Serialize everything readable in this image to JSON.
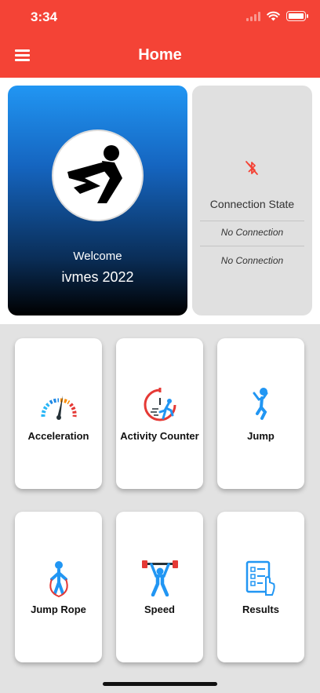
{
  "status_bar": {
    "time": "3:34"
  },
  "header": {
    "title": "Home",
    "menu_icon": "hamburger-menu-icon"
  },
  "welcome": {
    "greeting": "Welcome",
    "name": "ivmes 2022",
    "logo_icon": "ivmes-logo-icon"
  },
  "connection": {
    "icon": "bluetooth-disabled-icon",
    "title": "Connection State",
    "values": [
      "No Connection",
      "No Connection"
    ]
  },
  "tiles": [
    {
      "label": "Acceleration",
      "icon": "speedometer-icon"
    },
    {
      "label": "Activity Counter",
      "icon": "activity-timer-icon"
    },
    {
      "label": "Jump",
      "icon": "jump-person-icon"
    },
    {
      "label": "Jump Rope",
      "icon": "jump-rope-icon"
    },
    {
      "label": "Speed",
      "icon": "weightlifter-icon"
    },
    {
      "label": "Results",
      "icon": "results-list-icon"
    }
  ],
  "colors": {
    "app_bar": "#f44336",
    "accent_blue": "#2196f3",
    "accent_red": "#e53935",
    "background": "#e2e2e2"
  }
}
